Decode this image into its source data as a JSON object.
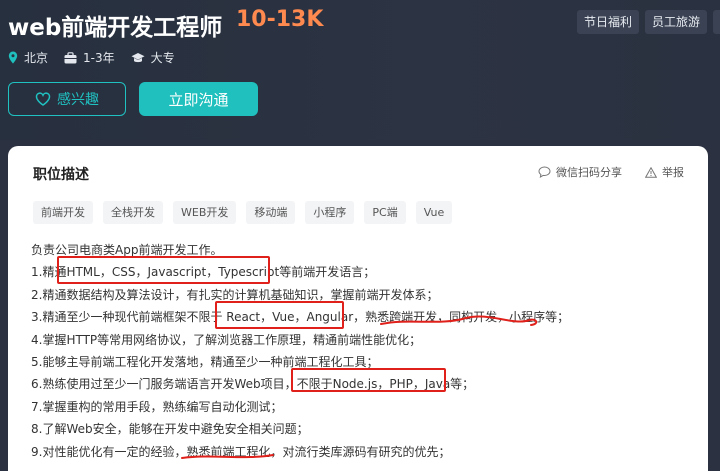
{
  "header": {
    "job_title": "web前端开发工程师",
    "salary": "10-13K",
    "benefits": [
      "节日福利",
      "员工旅游",
      "带"
    ],
    "location": "北京",
    "experience": "1-3年",
    "education": "大专",
    "interest_button": "感兴趣",
    "chat_button": "立即沟通"
  },
  "card": {
    "title": "职位描述",
    "share": "微信扫码分享",
    "report": "举报",
    "tags": [
      "前端开发",
      "全栈开发",
      "WEB开发",
      "移动端",
      "小程序",
      "PC端",
      "Vue"
    ],
    "lines": [
      "负责公司电商类App前端开发工作。",
      "1.精通HTML，CSS，Javascript，Typescript等前端开发语言；",
      "2.精通数据结构及算法设计，有扎实的计算机基础知识，掌握前端开发体系；",
      "3.精通至少一种现代前端框架不限于 React，Vue，Angular，熟悉跨端开发，同构开发，小程序等；",
      "4.掌握HTTP等常用网络协议，了解浏览器工作原理，精通前端性能优化；",
      "5.能够主导前端工程化开发落地，精通至少一种前端工程化工具；",
      "6.熟练使用过至少一门服务端语言开发Web项目，不限于Node.js，PHP，Java等；",
      "7.掌握重构的常用手段，熟练编写自动化测试；",
      "8.了解Web安全，能够在开发中避免安全相关问题；",
      "9.对性能优化有一定的经验，熟悉前端工程化，对流行类库源码有研究的优先；"
    ]
  },
  "colors": {
    "banner_bg": "#2b3140",
    "accent_teal": "#1fc0bd",
    "salary_orange": "#ff8a50",
    "annotation_red": "#e0201a"
  },
  "icons": {
    "location": "location-pin-icon",
    "experience": "briefcase-icon",
    "education": "graduation-cap-icon",
    "interest": "heart-icon",
    "share": "chat-bubble-icon",
    "report": "warning-triangle-icon"
  }
}
